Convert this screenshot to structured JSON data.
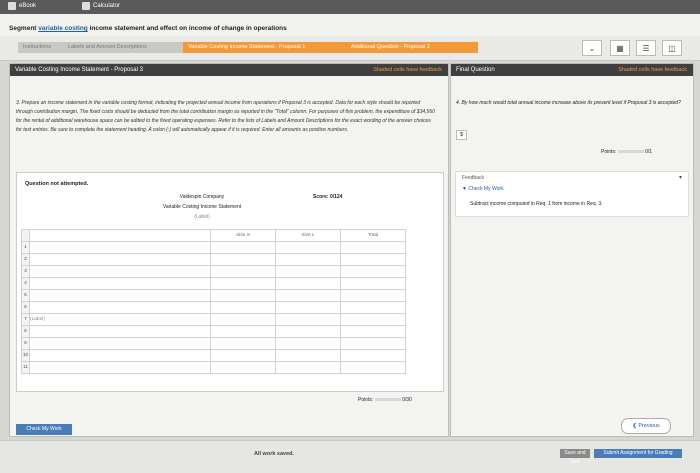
{
  "topbar": {
    "ebook": "eBook",
    "calculator": "Calculator"
  },
  "header": {
    "title_prefix": "Segment ",
    "title_link": "variable costing",
    "title_suffix": " income statement and effect on income of change in operations"
  },
  "tabs": [
    "Instructions",
    "Labels and Amount Descriptions",
    "Variable Costing Income Statement - Proposal 1",
    "Additional Question - Proposal 2"
  ],
  "main": {
    "header_left": "Variable Costing Income Statement - Proposal 3",
    "header_right": "Shaded cells have feedback",
    "question": "3. Prepare an income statement in the variable costing format, indicating the projected annual income from operations if Proposal 3 is accepted. Data for each style should be reported through contribution margin. The fixed costs should be deducted from the total contribution margin as reported in the \"Total\" column. For purposes of this problem, the expenditure of $34,560 for the rental of additional warehouse space can be added to the fixed operating expenses. Refer to the lists of Labels and Amount Descriptions for the exact wording of the answer choices for text entries. Be sure to complete the statement heading. A colon (:) will automatically appear if it is required. Enter all amounts as positive numbers.",
    "not_attempted": "Question not attempted.",
    "score": "Score: 0/124",
    "company": "Valdespin Company",
    "statement": "Variable Costing Income Statement",
    "label_placeholder": "(Label)",
    "col_headers": [
      "Size S",
      "Size L",
      "Total"
    ],
    "row_numbers": [
      "1",
      "2",
      "3",
      "4",
      "5",
      "6",
      "7",
      "8",
      "9",
      "10",
      "11"
    ],
    "row7_label": "(Label)",
    "points_label": "Points:",
    "points_value": "0/30",
    "check_btn": "Check My Work"
  },
  "side": {
    "header_left": "Final Question",
    "header_right": "Shaded cells have feedback",
    "question": "4. By how much would total annual income increase above its present level if Proposal 3 is accepted?",
    "answer_prefix": "$",
    "points_label": "Points:",
    "points_value": "0/1",
    "feedback_title": "Feedback",
    "check_link": "Check My Work",
    "feedback_text": "Subtract income computed in Req. 1 from income in Req. 3.",
    "previous": "Previous"
  },
  "footer": {
    "saved": "All work saved.",
    "save_exit": "Save and Exit",
    "submit": "Submit Assignment for Grading"
  }
}
